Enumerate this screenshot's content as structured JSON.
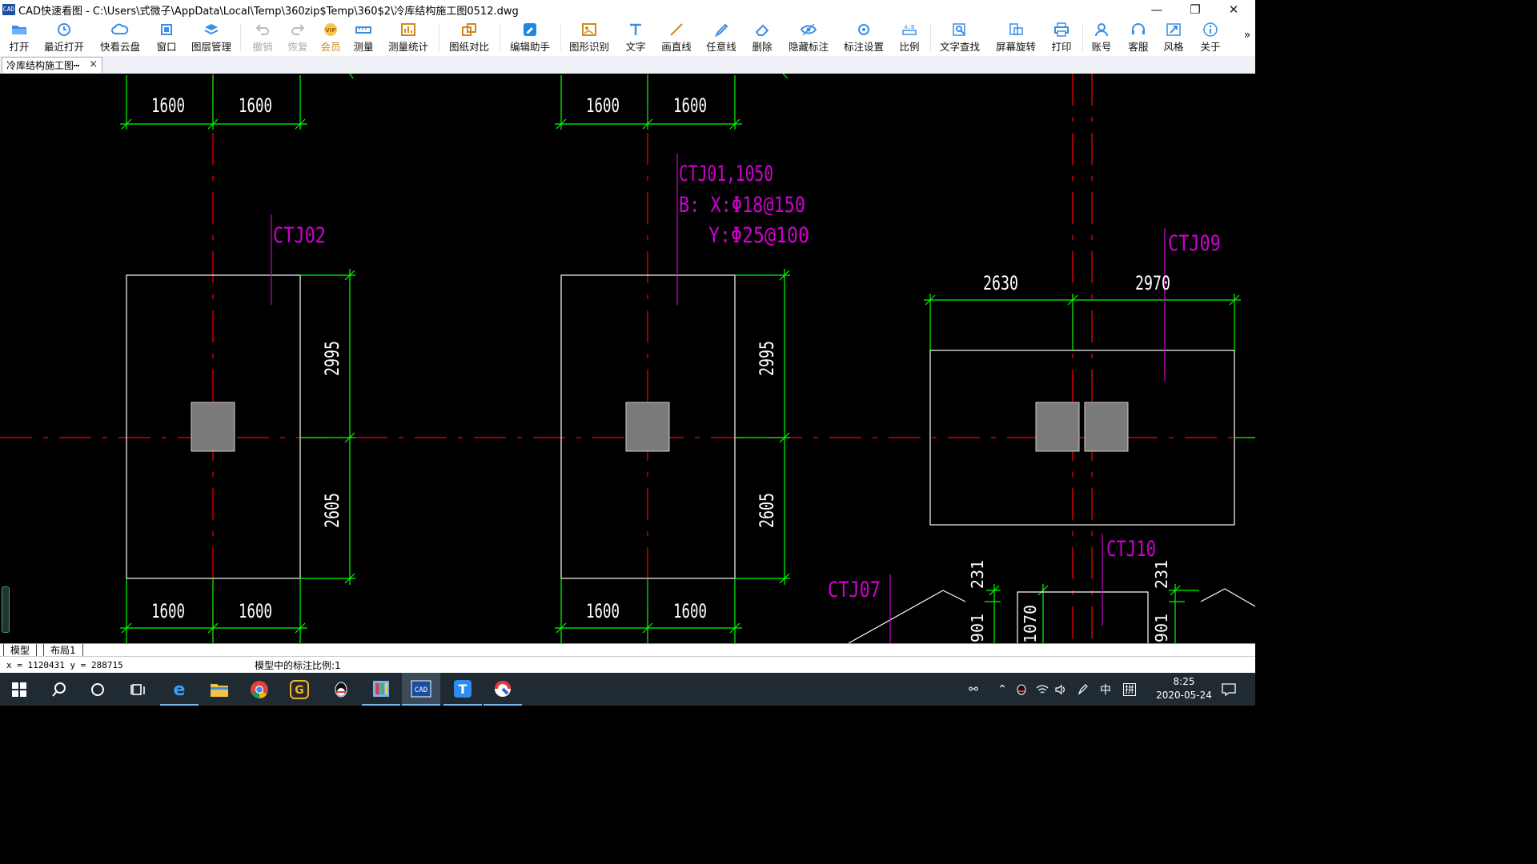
{
  "window": {
    "title": "CAD快速看图 - C:\\Users\\式微子\\AppData\\Local\\Temp\\360zip$Temp\\360$2\\冷库结构施工图0512.dwg",
    "app_icon_text": "CAD"
  },
  "toolbar": {
    "items": [
      {
        "label": "打开",
        "icon": "folder-open-icon"
      },
      {
        "label": "最近打开",
        "icon": "history-icon"
      },
      {
        "label": "快看云盘",
        "icon": "cloud-icon"
      },
      {
        "label": "窗口",
        "icon": "window-fit-icon"
      },
      {
        "label": "图层管理",
        "icon": "layers-icon"
      },
      {
        "label": "撤销",
        "icon": "undo-icon"
      },
      {
        "label": "恢复",
        "icon": "redo-icon"
      },
      {
        "label": "会员",
        "icon": "vip-icon"
      },
      {
        "label": "测量",
        "icon": "ruler-icon"
      },
      {
        "label": "测量统计",
        "icon": "measure-stats-icon"
      },
      {
        "label": "图纸对比",
        "icon": "compare-icon"
      },
      {
        "label": "编辑助手",
        "icon": "edit-assistant-icon"
      },
      {
        "label": "图形识别",
        "icon": "shape-recognize-icon"
      },
      {
        "label": "文字",
        "icon": "text-icon"
      },
      {
        "label": "画直线",
        "icon": "line-icon"
      },
      {
        "label": "任意线",
        "icon": "freehand-icon"
      },
      {
        "label": "删除",
        "icon": "eraser-icon"
      },
      {
        "label": "隐藏标注",
        "icon": "eye-hide-icon"
      },
      {
        "label": "标注设置",
        "icon": "annotation-settings-icon"
      },
      {
        "label": "比例",
        "icon": "scale-icon"
      },
      {
        "label": "文字查找",
        "icon": "text-search-icon"
      },
      {
        "label": "屏幕旋转",
        "icon": "rotate-screen-icon"
      },
      {
        "label": "打印",
        "icon": "printer-icon"
      },
      {
        "label": "账号",
        "icon": "user-icon"
      },
      {
        "label": "客服",
        "icon": "headset-icon"
      },
      {
        "label": "风格",
        "icon": "style-icon"
      },
      {
        "label": "关于",
        "icon": "info-icon"
      }
    ],
    "overflow": "»"
  },
  "doc_tab": {
    "label": "冷库结构施工图┅",
    "close": "×"
  },
  "drawing": {
    "dims": {
      "top_left": [
        "1600",
        "1600"
      ],
      "top_mid": [
        "1600",
        "1600"
      ],
      "bottom_left": [
        "1600",
        "1600"
      ],
      "bottom_mid": [
        "1600",
        "1600"
      ],
      "right_left_upper": "2995",
      "right_left_lower": "2605",
      "right_mid_upper": "2995",
      "right_mid_lower": "2605",
      "top_right": [
        "2630",
        "2970"
      ],
      "small": [
        "231",
        "901",
        "1070",
        "231",
        "901"
      ]
    },
    "labels": {
      "ctj02": "CTJ02",
      "ctj01_line1": "CTJ01,1050",
      "ctj01_line2": "B: X:Φ18@150",
      "ctj01_line3": "Y:Φ25@100",
      "ctj09": "CTJ09",
      "ctj10": "CTJ10",
      "ctj07": "CTJ07"
    },
    "colors": {
      "dimension": "#00ff00",
      "axis": "#ff0000",
      "label": "#d000d0",
      "outline": "#ffffff",
      "column": "#7a7a7a"
    }
  },
  "layout_tabs": [
    "模型",
    "布局1"
  ],
  "status": {
    "coords": "x = 1120431  y = 288715",
    "scale_text": "模型中的标注比例:1"
  },
  "taskbar": {
    "icons": [
      "windows-start-icon",
      "search-icon",
      "cortana-icon",
      "task-view-icon",
      "edge-icon",
      "file-explorer-icon",
      "chrome-icon",
      "g-app-icon",
      "qq-icon",
      "winrar-icon",
      "cad-viewer-icon",
      "t-app-icon",
      "paint-app-icon"
    ],
    "tray": {
      "ime_lang": "中",
      "ime_mode": "拼",
      "time": "8:25",
      "date": "2020-05-24"
    }
  }
}
